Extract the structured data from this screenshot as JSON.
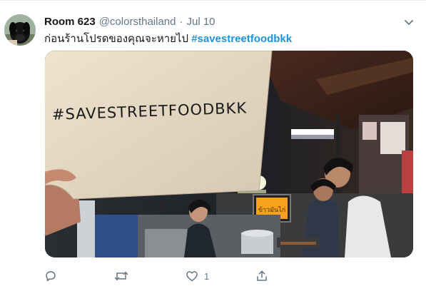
{
  "tweet": {
    "display_name": "Room 623",
    "handle": "@colorsthailand",
    "separator": "·",
    "date": "Jul 10",
    "text": "ก่อนร้านโปรดของคุณจะหายไป",
    "hashtag": "#savestreetfoodbkk"
  },
  "media": {
    "sign_text": "#SAVESTREETFOODBKK",
    "stall_sign_text": "ข้าวมันไก่"
  },
  "actions": {
    "reply_count": "",
    "retweet_count": "",
    "like_count": "1",
    "share_count": ""
  },
  "icons": {
    "reply": "reply-icon",
    "retweet": "retweet-icon",
    "like": "like-icon",
    "share": "share-icon",
    "caret": "chevron-down-icon"
  },
  "colors": {
    "hashtag": "#1b95e0",
    "secondary_text": "#657786"
  }
}
